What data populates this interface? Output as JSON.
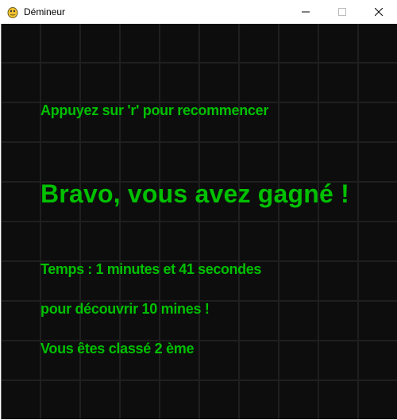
{
  "window": {
    "title": "Démineur",
    "icon": "pygame-snake-icon",
    "controls": [
      "minimize-icon",
      "maximize-icon",
      "close-icon"
    ]
  },
  "board": {
    "background_color": "#0d0d0d",
    "grid_color": "#1f1f1f"
  },
  "messages": {
    "restart": "Appuyez sur 'r' pour recommencer",
    "win": "Bravo, vous avez gagné !",
    "time": "Temps : 1 minutes et 41 secondes",
    "mines": "pour découvrir 10 mines !",
    "rank": "Vous êtes classé 2 ème",
    "text_color": "#00c000"
  }
}
